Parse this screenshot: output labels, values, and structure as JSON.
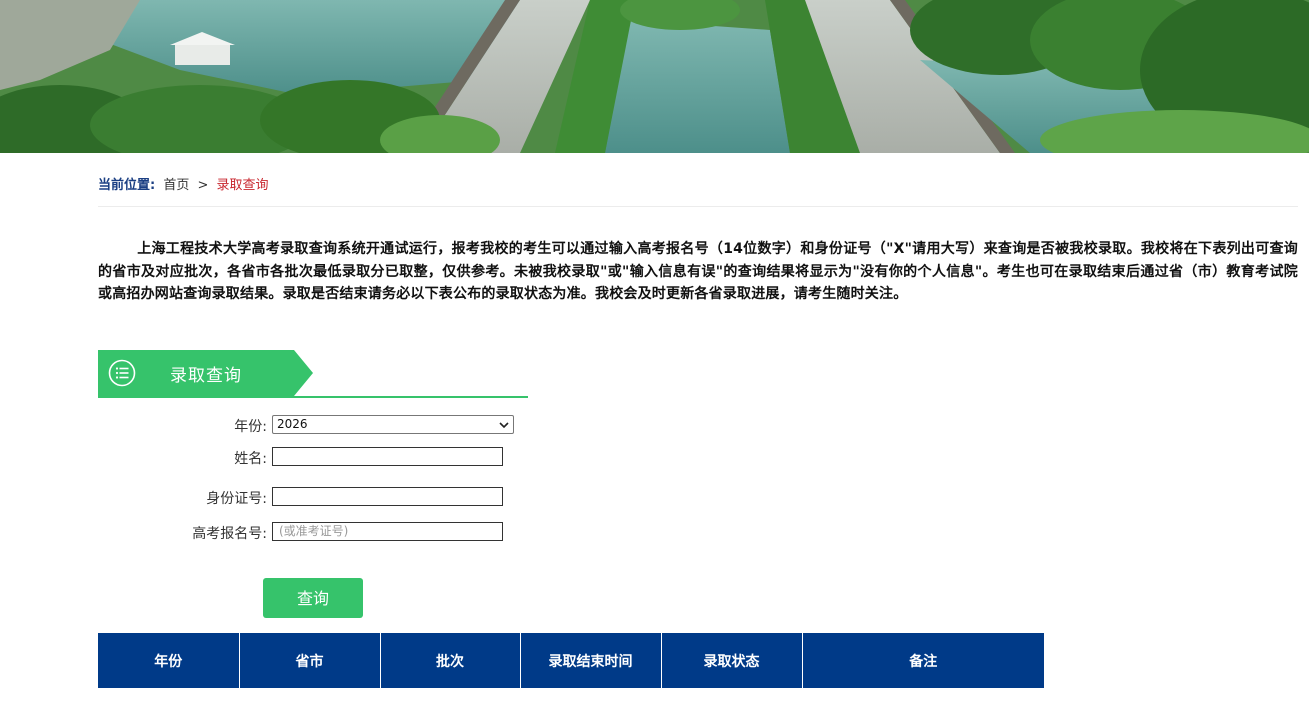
{
  "banner": {
    "image": "campus-scenery-banner"
  },
  "breadcrumb": {
    "label": "当前位置:",
    "home": "首页",
    "separator": ">",
    "current": "录取查询"
  },
  "intro": {
    "text": "上海工程技术大学高考录取查询系统开通试运行，报考我校的考生可以通过输入高考报名号（14位数字）和身份证号（\"X\"请用大写）来查询是否被我校录取。我校将在下表列出可查询的省市及对应批次，各省市各批次最低录取分已取整，仅供参考。未被我校录取\"或\"输入信息有误\"的查询结果将显示为\"没有你的个人信息\"。考生也可在录取结束后通过省（市）教育考试院或高招办网站查询录取结果。录取是否结束请务必以下表公布的录取状态为准。我校会及时更新各省录取进展，请考生随时关注。"
  },
  "section": {
    "title": "录取查询",
    "icon": "list-circle-icon"
  },
  "form": {
    "year_label": "年份:",
    "year_value": "2026",
    "name_label": "姓名:",
    "name_value": "",
    "id_label": "身份证号:",
    "id_value": "",
    "exam_label": "高考报名号:",
    "exam_placeholder": "(或准考证号)",
    "submit_label": "查询"
  },
  "table": {
    "columns": [
      "年份",
      "省市",
      "批次",
      "录取结束时间",
      "录取状态",
      "备注"
    ]
  },
  "colors": {
    "accent": "#36c36b",
    "table_header": "#003a88",
    "breadcrumb_label": "#1b3f83",
    "breadcrumb_current": "#c8262e"
  }
}
